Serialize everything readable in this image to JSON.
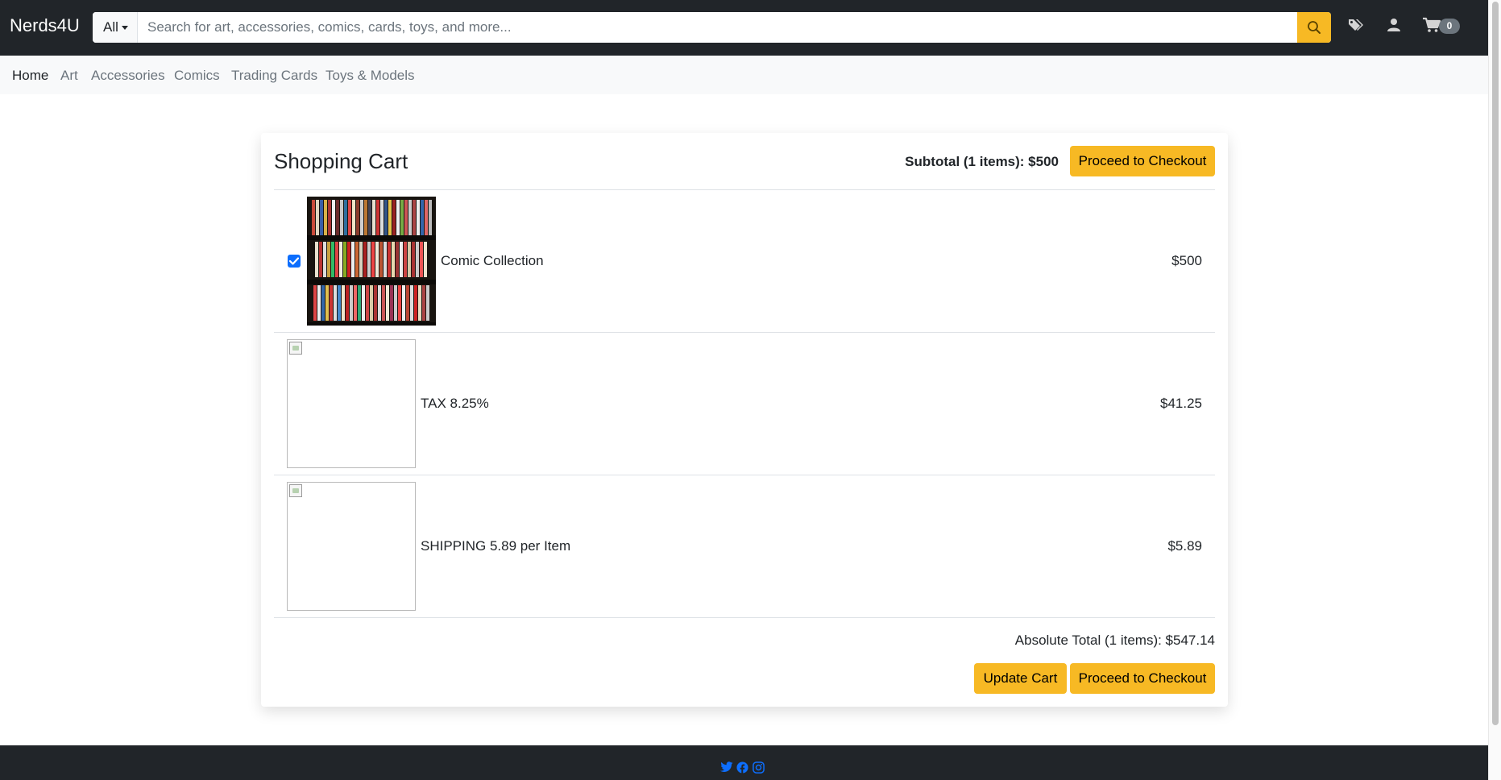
{
  "brand": "Nerds4U",
  "search": {
    "category": "All",
    "placeholder": "Search for art, accessories, comics, cards, toys, and more...",
    "value": ""
  },
  "header_icons": [
    "search-icon",
    "tag-icon",
    "user-icon",
    "cart-icon"
  ],
  "cart_count": "0",
  "nav": {
    "links": [
      "Home",
      "Art",
      "Accessories",
      "Comics",
      "Trading Cards",
      "Toys & Models"
    ],
    "active": "Home"
  },
  "cart": {
    "title": "Shopping Cart",
    "subtotal": "Subtotal (1 items): $500",
    "checkout_label": "Proceed to Checkout",
    "items": [
      {
        "name": "Comic Collection",
        "price": "$500",
        "checked": true
      },
      {
        "name": "TAX 8.25%",
        "price": "$41.25"
      },
      {
        "name": "SHIPPING 5.89 per Item",
        "price": "$5.89"
      }
    ],
    "absolute_total": "Absolute Total (1 items): $547.14",
    "update_label": "Update Cart"
  },
  "footer": {
    "social_icons": [
      "twitter-icon",
      "facebook-icon",
      "instagram-icon"
    ]
  },
  "colors": {
    "navbar": "#212529",
    "accent": "#f7b924",
    "nav_bg": "#f8f9fa",
    "social": "#0d6efd",
    "checkbox": "#0d6efd"
  }
}
